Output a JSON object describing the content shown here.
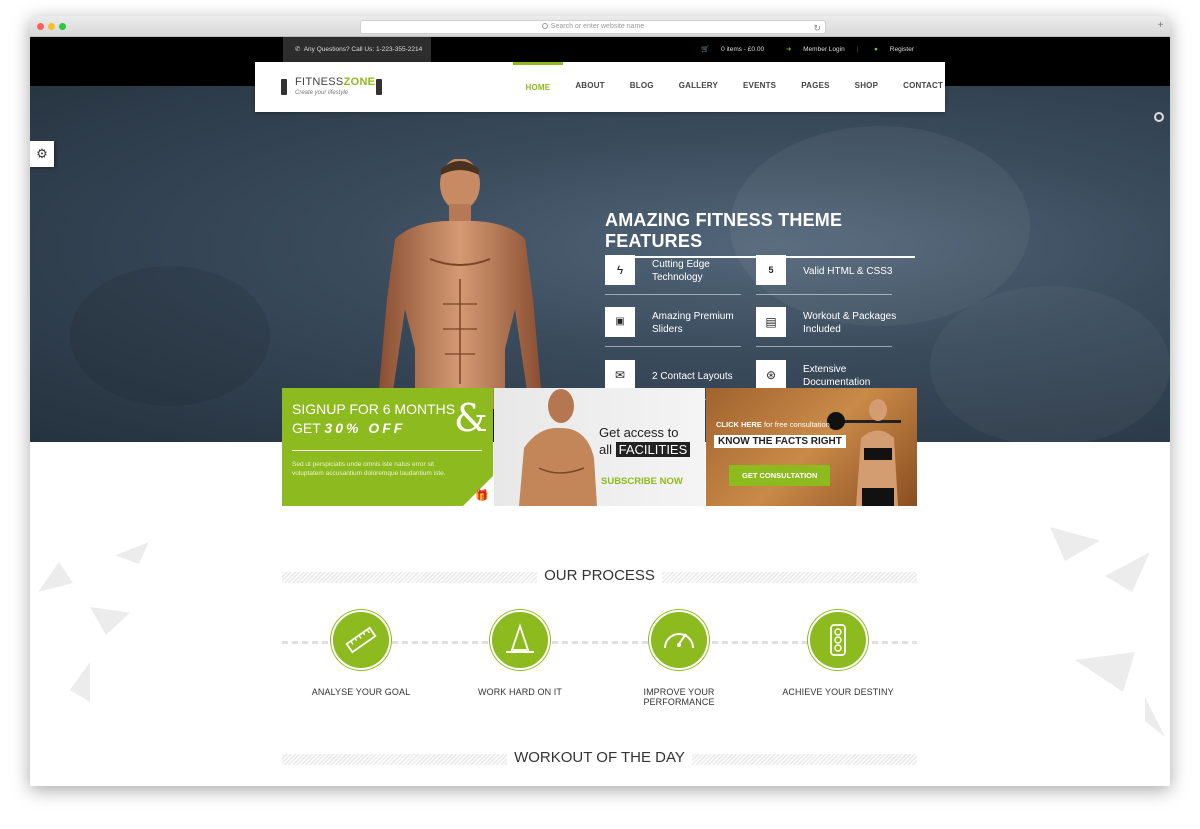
{
  "browser": {
    "url_placeholder": "Search or enter website name"
  },
  "topbar": {
    "phone_text": "Any Questions? Call Us: 1-223-355-2214",
    "cart_text": "0 items - £0.00",
    "login_label": "Member Login",
    "register_label": "Register"
  },
  "logo": {
    "name_part1": "FITNESS",
    "name_part2": "ZONE",
    "tagline": "Create your lifestyle"
  },
  "nav": {
    "items": [
      "HOME",
      "ABOUT",
      "BLOG",
      "GALLERY",
      "EVENTS",
      "PAGES",
      "SHOP",
      "CONTACT"
    ],
    "active": "HOME"
  },
  "hero": {
    "features_title": "AMAZING FITNESS THEME FEATURES",
    "features": [
      {
        "icon": "bolt-icon",
        "label": "Cutting Edge Technology"
      },
      {
        "icon": "html5-icon",
        "label": "Valid HTML & CSS3"
      },
      {
        "icon": "image-icon",
        "label": "Amazing Premium Sliders"
      },
      {
        "icon": "document-icon",
        "label": "Workout & Packages Included"
      },
      {
        "icon": "envelope-icon",
        "label": "2 Contact Layouts"
      },
      {
        "icon": "lifebuoy-icon",
        "label": "Extensive Documentation"
      }
    ]
  },
  "banners": {
    "signup": {
      "line1": "SIGNUP FOR 6 MONTHS",
      "line2": "GET",
      "percent": "30% OFF",
      "amp": "&",
      "body": "Sed ut perspiciatis unde omnis iste natus error sit voluptatem accusantium doloremque laudantium iste."
    },
    "facilities": {
      "line1": "Get access to",
      "line2_plain": "all",
      "line2_highlight": "FACILITIES",
      "cta": "SUBSCRIBE NOW"
    },
    "consult": {
      "click_bold": "CLICK HERE",
      "click_rest": "for free consultation",
      "headline": "KNOW THE FACTS RIGHT",
      "cta": "GET CONSULTATION"
    }
  },
  "process": {
    "title": "OUR PROCESS",
    "steps": [
      {
        "icon": "ruler-icon",
        "label": "ANALYSE YOUR GOAL"
      },
      {
        "icon": "cone-icon",
        "label": "WORK HARD ON IT"
      },
      {
        "icon": "speedometer-icon",
        "label": "IMPROVE YOUR PERFORMANCE"
      },
      {
        "icon": "traffic-light-icon",
        "label": "ACHIEVE YOUR DESTINY"
      }
    ]
  },
  "workout": {
    "title": "WORKOUT OF THE DAY"
  },
  "colors": {
    "accent": "#8dba1f",
    "topbar": "#000000",
    "hero_bg": "#3a4b5c"
  }
}
